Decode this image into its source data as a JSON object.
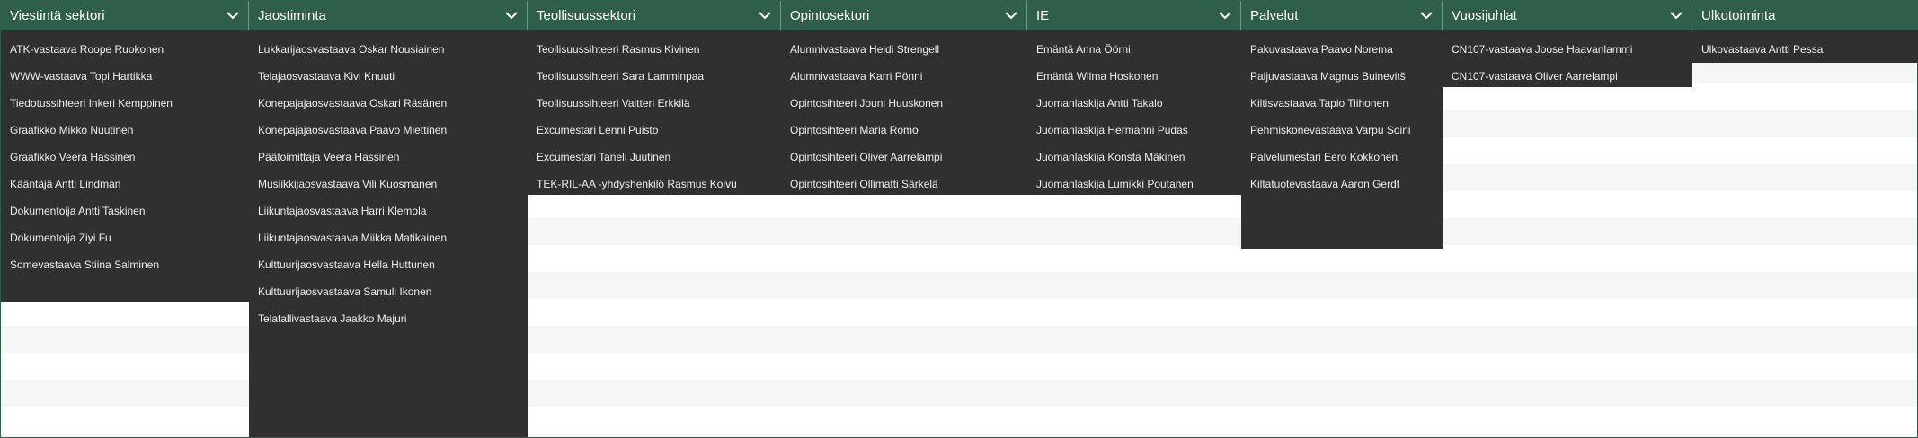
{
  "columns": [
    {
      "title": "Viestintä sektori",
      "items": [
        "ATK-vastaava Roope Ruokonen",
        "WWW-vastaava Topi Hartikka",
        "Tiedotussihteeri Inkeri Kemppinen",
        "Graafikko Mikko Nuutinen",
        "Graafikko Veera Hassinen",
        "Kääntäjä Antti Lindman",
        "Dokumentoija Antti Taskinen",
        "Dokumentoija Ziyi Fu",
        "Somevastaava Stiina Salminen"
      ]
    },
    {
      "title": "Jaostiminta",
      "items": [
        "Lukkarijaosvastaava Oskar Nousiainen",
        "Telajaosvastaava Kivi Knuuti",
        "Konepajajaosvastaava Oskari Räsänen",
        "Konepajajaosvastaava Paavo Miettinen",
        "Päätoimittaja Veera Hassinen",
        "Musiikkijaosvastaava Vili Kuosmanen",
        "Liikuntajaosvastaava Harri Klemola",
        "Liikuntajaosvastaava Miikka Matikainen",
        "Kulttuurijaosvastaava Hella Huttunen",
        "Kulttuurijaosvastaava Samuli Ikonen",
        "Telatallivastaava Jaakko Majuri"
      ]
    },
    {
      "title": "Teollisuussektori",
      "items": [
        "Teollisuussihteeri Rasmus Kivinen",
        "Teollisuussihteeri Sara Lamminpaa",
        "Teollisuussihteeri Valtteri Erkkilä",
        "Excumestari Lenni Puisto",
        "Excumestari Taneli Juutinen",
        "TEK-RIL-AA -yhdyshenkilö Rasmus Koivu"
      ]
    },
    {
      "title": "Opintosektori",
      "items": [
        "Alumnivastaava Heidi Strengell",
        "Alumnivastaava Karri Pönni",
        "Opintosihteeri Jouni Huuskonen",
        "Opintosihteeri Maria Romo",
        "Opintosihteeri Oliver Aarrelampi",
        "Opintosihteeri Ollimatti Särkelä"
      ]
    },
    {
      "title": "IE",
      "items": [
        "Emäntä Anna Öörni",
        "Emäntä Wilma Hoskonen",
        "Juomanlaskija Antti Takalo",
        "Juomanlaskija Hermanni Pudas",
        "Juomanlaskija Konsta Mäkinen",
        "Juomanlaskija Lumikki Poutanen"
      ]
    },
    {
      "title": "Palvelut",
      "items": [
        "Pakuvastaava Paavo Norema",
        "Paljuvastaava Magnus Buinevitš",
        "Kiltisvastaava Tapio Tiihonen",
        "Pehmiskonevastaava Varpu Soini",
        "Palvelumestari Eero Kokkonen",
        "Kiltatuotevastaava Aaron Gerdt"
      ]
    },
    {
      "title": "Vuosijuhlat",
      "items": [
        "CN107-vastaava Joose Haavanlammi",
        "CN107-vastaava Oliver Aarrelampi"
      ]
    },
    {
      "title": "Ulkotoiminta",
      "items": [
        "Ulkovastaava Antti Pessa"
      ]
    }
  ],
  "icons": {
    "dropdown": "chevron-down-icon"
  },
  "colors": {
    "header": "#2f5f49",
    "panel": "#303030",
    "text": "#ffffff"
  }
}
